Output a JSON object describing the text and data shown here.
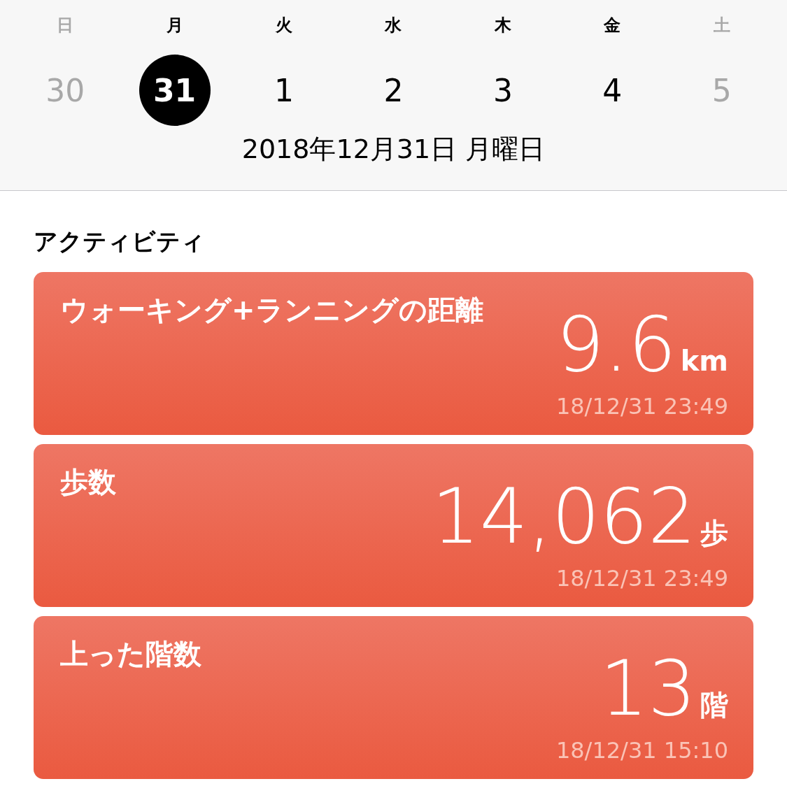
{
  "week": {
    "days": [
      {
        "weekday": "日",
        "date": "30",
        "dimmed": true,
        "selected": false
      },
      {
        "weekday": "月",
        "date": "31",
        "dimmed": false,
        "selected": true
      },
      {
        "weekday": "火",
        "date": "1",
        "dimmed": false,
        "selected": false
      },
      {
        "weekday": "水",
        "date": "2",
        "dimmed": false,
        "selected": false
      },
      {
        "weekday": "木",
        "date": "3",
        "dimmed": false,
        "selected": false
      },
      {
        "weekday": "金",
        "date": "4",
        "dimmed": false,
        "selected": false
      },
      {
        "weekday": "土",
        "date": "5",
        "dimmed": true,
        "selected": false
      }
    ],
    "full_date": "2018年12月31日 月曜日"
  },
  "section": {
    "title": "アクティビティ",
    "cards": [
      {
        "title": "ウォーキング+ランニングの距離",
        "value": "9.6",
        "unit": "km",
        "timestamp": "18/12/31 23:49"
      },
      {
        "title": "歩数",
        "value": "14,062",
        "unit": "歩",
        "timestamp": "18/12/31 23:49"
      },
      {
        "title": "上った階数",
        "value": "13",
        "unit": "階",
        "timestamp": "18/12/31 15:10"
      }
    ]
  }
}
